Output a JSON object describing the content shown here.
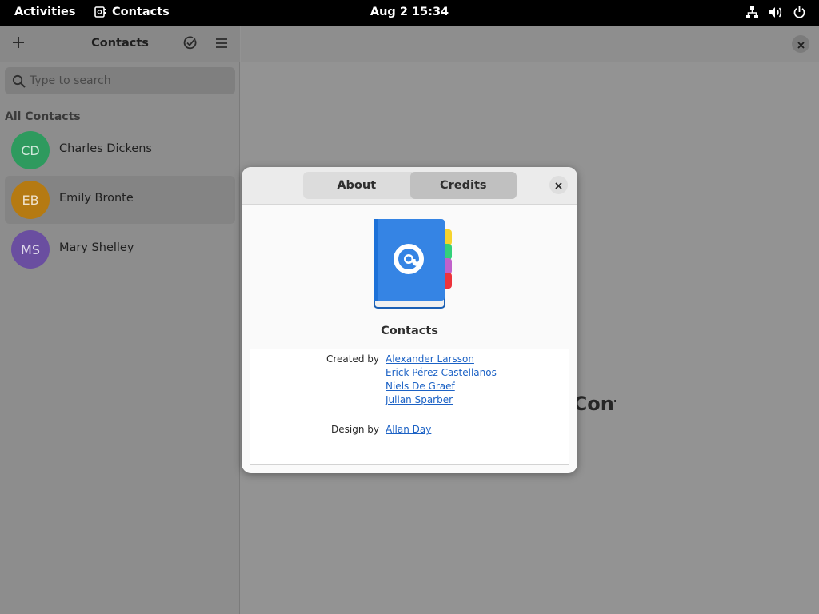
{
  "topbar": {
    "activities": "Activities",
    "app_name": "Contacts",
    "clock": "Aug 2  15:34"
  },
  "sidebar": {
    "title": "Contacts",
    "search_placeholder": "Type to search",
    "section_label": "All Contacts",
    "contacts": [
      {
        "initials": "CD",
        "name": "Charles Dickens",
        "color": "#2e9a5e",
        "selected": false
      },
      {
        "initials": "EB",
        "name": "Emily Bronte",
        "color": "#b57a12",
        "selected": true
      },
      {
        "initials": "MS",
        "name": "Mary Shelley",
        "color": "#6a4ea0",
        "selected": false
      }
    ]
  },
  "main": {
    "empty_text": "Select a Contact"
  },
  "dialog": {
    "tabs": [
      "About",
      "Credits"
    ],
    "active_tab": "Credits",
    "app_name": "Contacts",
    "credits": {
      "created_by_label": "Created by",
      "created_by": [
        "Alexander Larsson",
        "Erick Pérez Castellanos",
        "Niels De Graef",
        "Julian Sparber"
      ],
      "design_by_label": "Design by",
      "design_by": [
        "Allan Day"
      ]
    }
  },
  "colors": {
    "link": "#1c62c5",
    "icon_blue": "#3584e4"
  }
}
